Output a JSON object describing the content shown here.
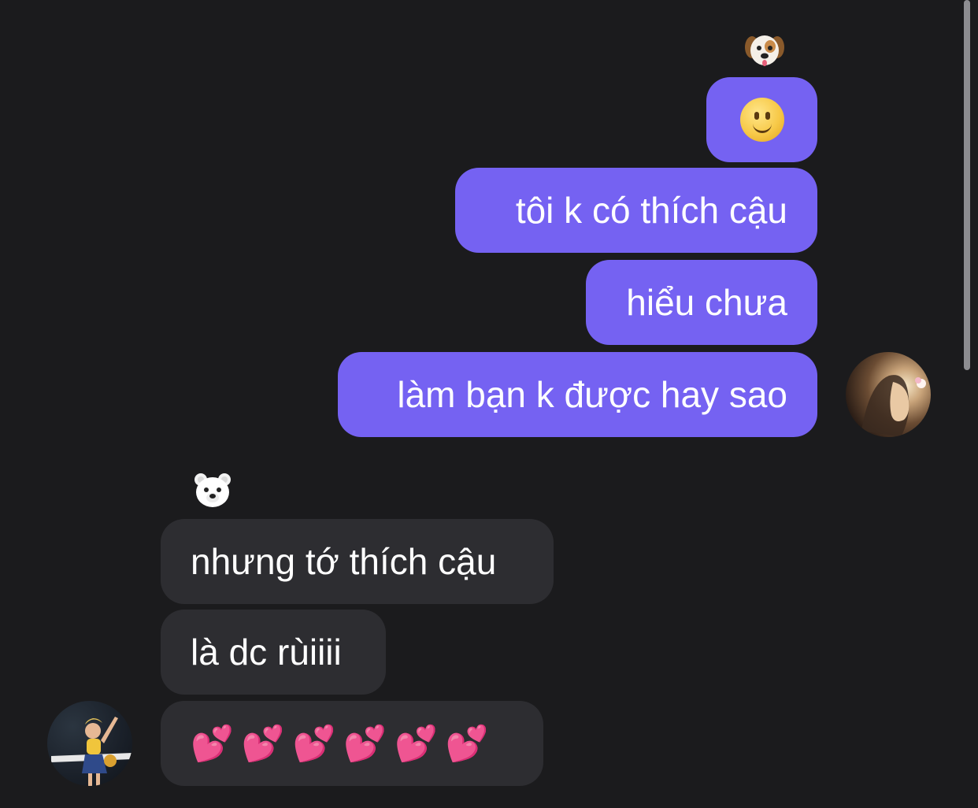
{
  "conversation": {
    "sent_messages": [
      {
        "id": "smile",
        "emoji": "🙂"
      },
      {
        "id": "m1",
        "text": "tôi k có thích cậu"
      },
      {
        "id": "m2",
        "text": "hiểu chưa"
      },
      {
        "id": "m3",
        "text": "làm bạn k được hay sao"
      }
    ],
    "sent_reaction": {
      "emoji": "🐶",
      "icon": "dog-face-icon"
    },
    "received_reaction": {
      "emoji": "🐻‍❄️",
      "icon": "polar-bear-icon"
    },
    "received_messages": [
      {
        "id": "r1",
        "text": "nhưng tớ thích cậu"
      },
      {
        "id": "r2",
        "text": "là dc rùiiii"
      },
      {
        "id": "r3",
        "emoji": "💕💕💕💕💕💕"
      }
    ]
  },
  "colors": {
    "background": "#1b1b1d",
    "sent_bubble": "#7562f2",
    "received_bubble": "#2d2d31",
    "text": "#ffffff"
  },
  "icons": {
    "sent_avatar": "user-avatar-photo",
    "received_avatar": "contact-avatar-photo",
    "smile": "slightly-smiling-face-icon",
    "hearts": "two-hearts-icon"
  }
}
